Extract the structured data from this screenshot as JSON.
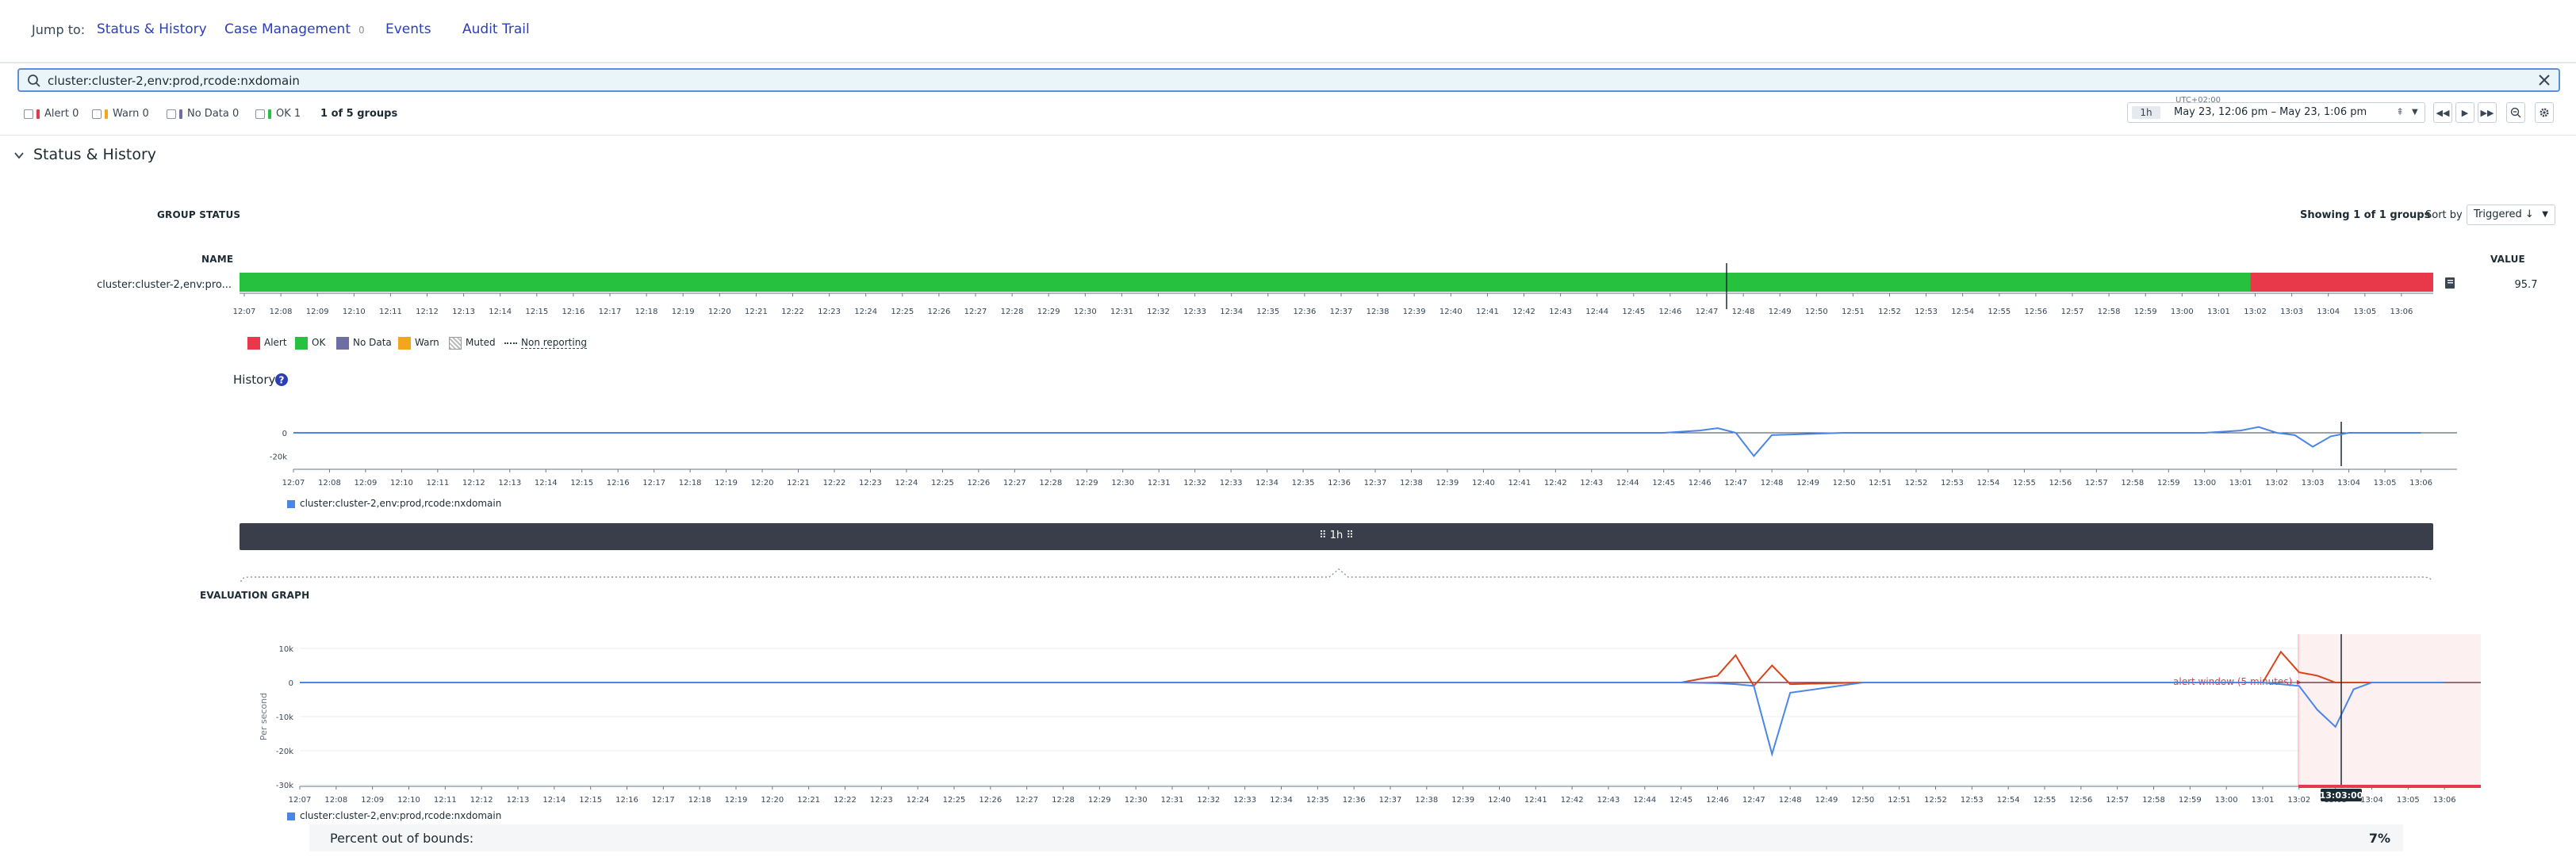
{
  "jump": {
    "label": "Jump to:",
    "links": [
      {
        "label": "Status & History"
      },
      {
        "label": "Case Management",
        "badge": "0"
      },
      {
        "label": "Events"
      },
      {
        "label": "Audit Trail"
      }
    ]
  },
  "search": {
    "value": "cluster:cluster-2,env:prod,rcode:nxdomain",
    "icon": "search-icon"
  },
  "filters": [
    {
      "label": "Alert 0",
      "color": "#e8394b"
    },
    {
      "label": "Warn 0",
      "color": "#f3a51d"
    },
    {
      "label": "No Data 0",
      "color": "#6e6ea5"
    },
    {
      "label": "OK 1",
      "color": "#27c140"
    }
  ],
  "groups_count": "1 of 5 groups",
  "time": {
    "timezone": "UTC+02:00",
    "duration": "1h",
    "range": "May 23, 12:06 pm – May 23, 1:06 pm"
  },
  "section": {
    "title": "Status & History"
  },
  "group_status": {
    "title": "GROUP STATUS",
    "showing": "Showing 1 of 1 groups",
    "sort_label": "Sort by",
    "sort_value": "Triggered ↓",
    "name_header": "NAME",
    "value_header": "VALUE",
    "row": {
      "name": "cluster:cluster-2,env:pro...",
      "value": "95.7"
    },
    "status_segments": [
      {
        "state": "OK",
        "from": "12:07",
        "to": "13:02"
      },
      {
        "state": "Alert",
        "from": "13:02",
        "to": "13:07"
      }
    ],
    "ticks": [
      "12:07",
      "12:08",
      "12:09",
      "12:10",
      "12:11",
      "12:12",
      "12:13",
      "12:14",
      "12:15",
      "12:16",
      "12:17",
      "12:18",
      "12:19",
      "12:20",
      "12:21",
      "12:22",
      "12:23",
      "12:24",
      "12:25",
      "12:26",
      "12:27",
      "12:28",
      "12:29",
      "12:30",
      "12:31",
      "12:32",
      "12:33",
      "12:34",
      "12:35",
      "12:36",
      "12:37",
      "12:38",
      "12:39",
      "12:40",
      "12:41",
      "12:42",
      "12:43",
      "12:44",
      "12:45",
      "12:46",
      "12:47",
      "12:48",
      "12:49",
      "12:50",
      "12:51",
      "12:52",
      "12:53",
      "12:54",
      "12:55",
      "12:56",
      "12:57",
      "12:58",
      "12:59",
      "13:00",
      "13:01",
      "13:02",
      "13:03",
      "13:04",
      "13:05",
      "13:06"
    ]
  },
  "legend": [
    {
      "label": "Alert",
      "color": "#e8394b"
    },
    {
      "label": "OK",
      "color": "#27c140"
    },
    {
      "label": "No Data",
      "color": "#6e6ea5"
    },
    {
      "label": "Warn",
      "color": "#f3a51d"
    },
    {
      "label": "Muted",
      "color": "#cccccc"
    },
    {
      "label": "Non reporting",
      "color": "#3a4654"
    }
  ],
  "history": {
    "title": "History",
    "series_name": "cluster:cluster-2,env:prod,rcode:nxdomain"
  },
  "darkbar": {
    "label": "1h"
  },
  "evaluation": {
    "title": "EVALUATION GRAPH",
    "ylabel": "Per second",
    "alert_window": "alert window (5 minutes)",
    "cursor_time": "13:03:00",
    "series_name": "cluster:cluster-2,env:prod,rcode:nxdomain"
  },
  "out_of_bounds": {
    "label": "Percent out of bounds:",
    "value": "7%"
  },
  "chart_data": [
    {
      "type": "line",
      "title": "History",
      "xlabel": "",
      "ylabel": "",
      "x": [
        "12:07",
        "12:12",
        "12:17",
        "12:22",
        "12:27",
        "12:32",
        "12:37",
        "12:42",
        "12:45",
        "12:46",
        "12:46:30",
        "12:47",
        "12:47:30",
        "12:48",
        "12:50",
        "12:55",
        "13:00",
        "13:01",
        "13:01:30",
        "13:02",
        "13:02:30",
        "13:03",
        "13:03:30",
        "13:04",
        "13:05",
        "13:06"
      ],
      "ylim": [
        -30000,
        15000
      ],
      "y_ticks": [
        "0",
        "-20k"
      ],
      "series": [
        {
          "values": [
            0,
            0,
            0,
            0,
            0,
            0,
            0,
            0,
            0,
            2000,
            4000,
            0,
            -20000,
            -2000,
            0,
            0,
            0,
            2000,
            5000,
            0,
            -2000,
            -12000,
            -3000,
            0,
            0,
            0
          ]
        }
      ],
      "grid": false
    },
    {
      "type": "line",
      "title": "EVALUATION GRAPH",
      "xlabel": "",
      "ylabel": "Per second",
      "x": [
        "12:07",
        "12:12",
        "12:17",
        "12:22",
        "12:27",
        "12:32",
        "12:37",
        "12:42",
        "12:45",
        "12:46",
        "12:46:30",
        "12:47",
        "12:47:30",
        "12:48",
        "12:50",
        "12:55",
        "13:00",
        "13:01",
        "13:01:30",
        "13:02",
        "13:02:30",
        "13:03",
        "13:03:30",
        "13:04",
        "13:05",
        "13:06"
      ],
      "ylim": [
        -30000,
        10000
      ],
      "y_ticks": [
        "10k",
        "0",
        "-10k",
        "-20k",
        "-30k"
      ],
      "series": [
        {
          "values": [
            0,
            0,
            0,
            0,
            0,
            0,
            0,
            0,
            0,
            -200,
            -500,
            -1000,
            -21000,
            -3000,
            0,
            0,
            0,
            0,
            -500,
            -1000,
            -8000,
            -13000,
            -2000,
            0,
            0,
            0
          ]
        },
        {
          "values": [
            0,
            0,
            0,
            0,
            0,
            0,
            0,
            0,
            0,
            2000,
            8000,
            -1000,
            5000,
            -500,
            0,
            0,
            0,
            0,
            9000,
            3000,
            2000,
            0,
            0,
            0,
            0,
            0
          ]
        }
      ],
      "grid": true
    }
  ]
}
